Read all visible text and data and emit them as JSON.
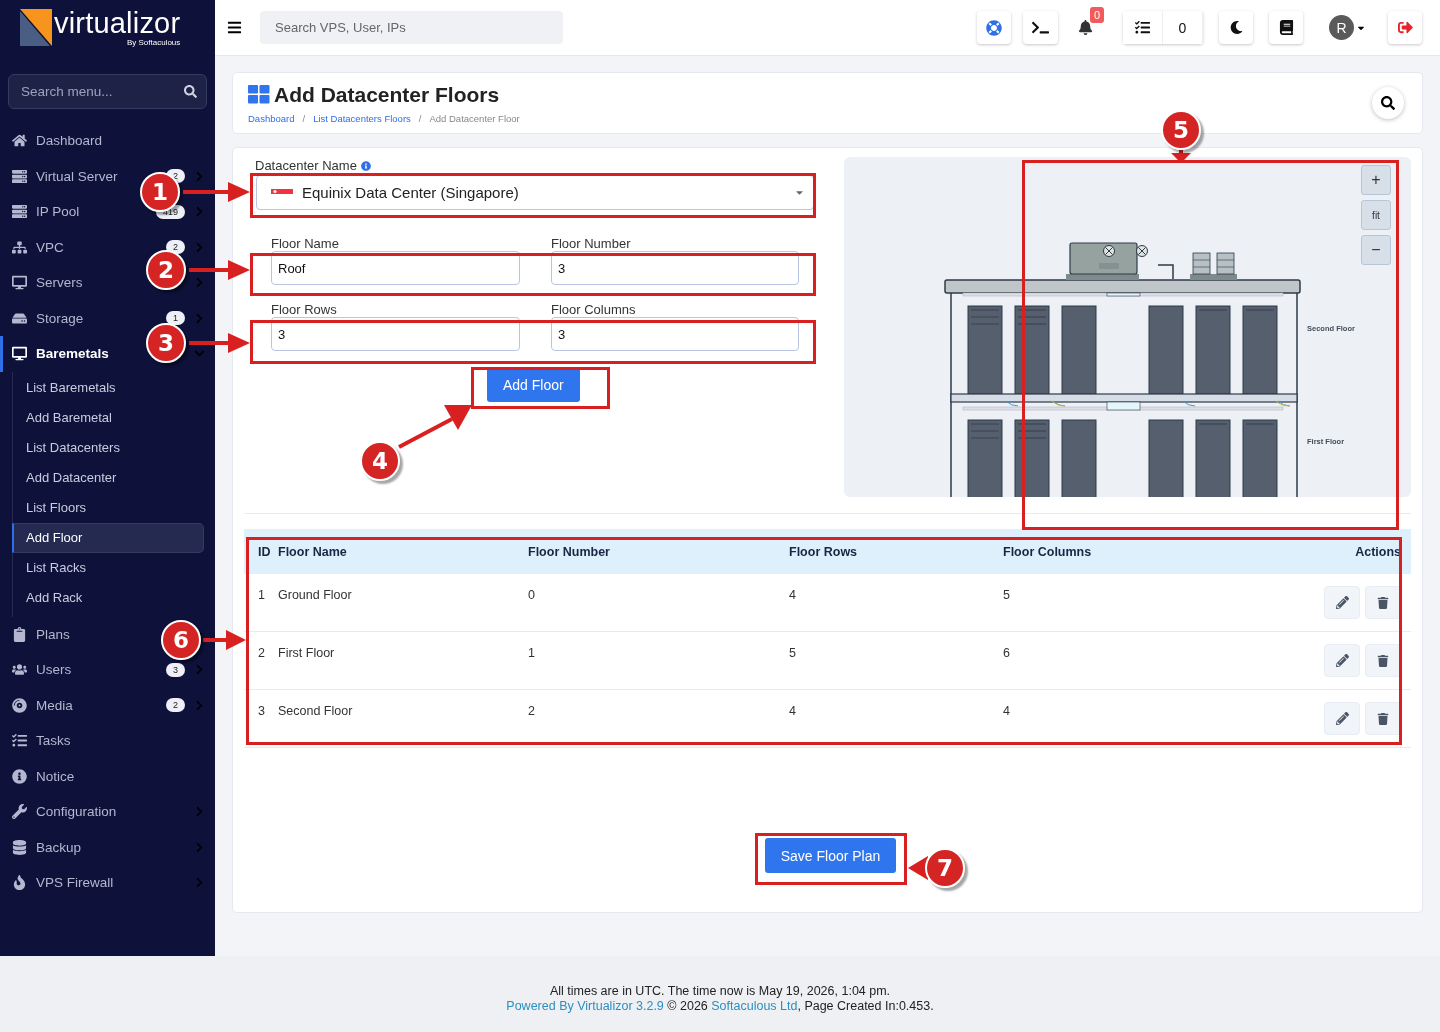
{
  "brand": {
    "name": "virtualizor",
    "byline": "By Softaculous"
  },
  "sidebar": {
    "search_placeholder": "Search menu...",
    "items": [
      {
        "label": "Dashboard",
        "selected": false
      },
      {
        "label": "Virtual Server",
        "badge": "2",
        "expanded": false,
        "selected": false
      },
      {
        "label": "IP Pool",
        "badge": "419",
        "expanded": false,
        "selected": false
      },
      {
        "label": "VPC",
        "badge": "2",
        "expanded": false,
        "selected": false
      },
      {
        "label": "Servers",
        "expanded": false,
        "selected": false
      },
      {
        "label": "Storage",
        "badge": "1",
        "expanded": false,
        "selected": false
      },
      {
        "label": "Baremetals",
        "expanded": true,
        "selected": true,
        "children": [
          {
            "label": "List Baremetals",
            "selected": false
          },
          {
            "label": "Add Baremetal",
            "selected": false
          },
          {
            "label": "List Datacenters",
            "selected": false
          },
          {
            "label": "Add Datacenter",
            "selected": false
          },
          {
            "label": "List Floors",
            "selected": false
          },
          {
            "label": "Add Floor",
            "selected": true
          },
          {
            "label": "List Racks",
            "selected": false
          },
          {
            "label": "Add Rack",
            "selected": false
          }
        ]
      },
      {
        "label": "Plans",
        "expanded": false,
        "selected": false
      },
      {
        "label": "Users",
        "badge": "3",
        "expanded": false,
        "selected": false
      },
      {
        "label": "Media",
        "badge": "2",
        "expanded": false,
        "selected": false
      },
      {
        "label": "Tasks",
        "selected": false
      },
      {
        "label": "Notice",
        "selected": false
      },
      {
        "label": "Configuration",
        "expanded": false,
        "selected": false
      },
      {
        "label": "Backup",
        "expanded": false,
        "selected": false
      },
      {
        "label": "VPS Firewall",
        "expanded": false,
        "selected": false
      }
    ]
  },
  "topbar": {
    "search_placeholder": "Search VPS, User, IPs",
    "notifications": "0",
    "tasks": "0",
    "avatar": "R"
  },
  "page": {
    "title": "Add Datacenter Floors",
    "breadcrumb": [
      {
        "label": "Dashboard",
        "kind": "link"
      },
      {
        "label": "/",
        "kind": "separator"
      },
      {
        "label": "List Datacenters Floors",
        "kind": "link"
      },
      {
        "label": "/",
        "kind": "separator"
      },
      {
        "label": "Add Datacenter Floor",
        "kind": "current"
      }
    ]
  },
  "form": {
    "datacenter_label": "Datacenter Name",
    "datacenter_value": "Equinix Data Center (Singapore)",
    "fields": [
      {
        "label": "Floor Name",
        "value": "Roof"
      },
      {
        "label": "Floor Number",
        "value": "3"
      },
      {
        "label": "Floor Rows",
        "value": "3"
      },
      {
        "label": "Floor Columns",
        "value": "3"
      }
    ],
    "submit": "Add Floor"
  },
  "diagram": {
    "zoom_in": "+",
    "fit": "fit",
    "zoom_out": "−",
    "floors": [
      "Second Floor",
      "First Floor"
    ]
  },
  "table": {
    "columns": [
      "ID",
      "Floor Name",
      "Floor Number",
      "Floor Rows",
      "Floor Columns",
      "Actions"
    ],
    "rows": [
      {
        "id": "1",
        "name": "Ground Floor",
        "number": "0",
        "rows": "4",
        "columns": "5"
      },
      {
        "id": "2",
        "name": "First Floor",
        "number": "1",
        "rows": "5",
        "columns": "6"
      },
      {
        "id": "3",
        "name": "Second Floor",
        "number": "2",
        "rows": "4",
        "columns": "4"
      }
    ]
  },
  "save": "Save Floor Plan",
  "footer": {
    "time_note": "All times are in UTC. The time now is May 19, 2026, 1:04 pm.",
    "powered": "Powered By Virtualizor 3.2.9",
    "copyright": " © 2026 ",
    "company": "Softaculous Ltd",
    "created": ", Page Created In:0.453."
  },
  "annotations": [
    {
      "label": "1"
    },
    {
      "label": "2"
    },
    {
      "label": "3"
    },
    {
      "label": "4"
    },
    {
      "label": "5"
    },
    {
      "label": "6"
    },
    {
      "label": "7"
    }
  ]
}
